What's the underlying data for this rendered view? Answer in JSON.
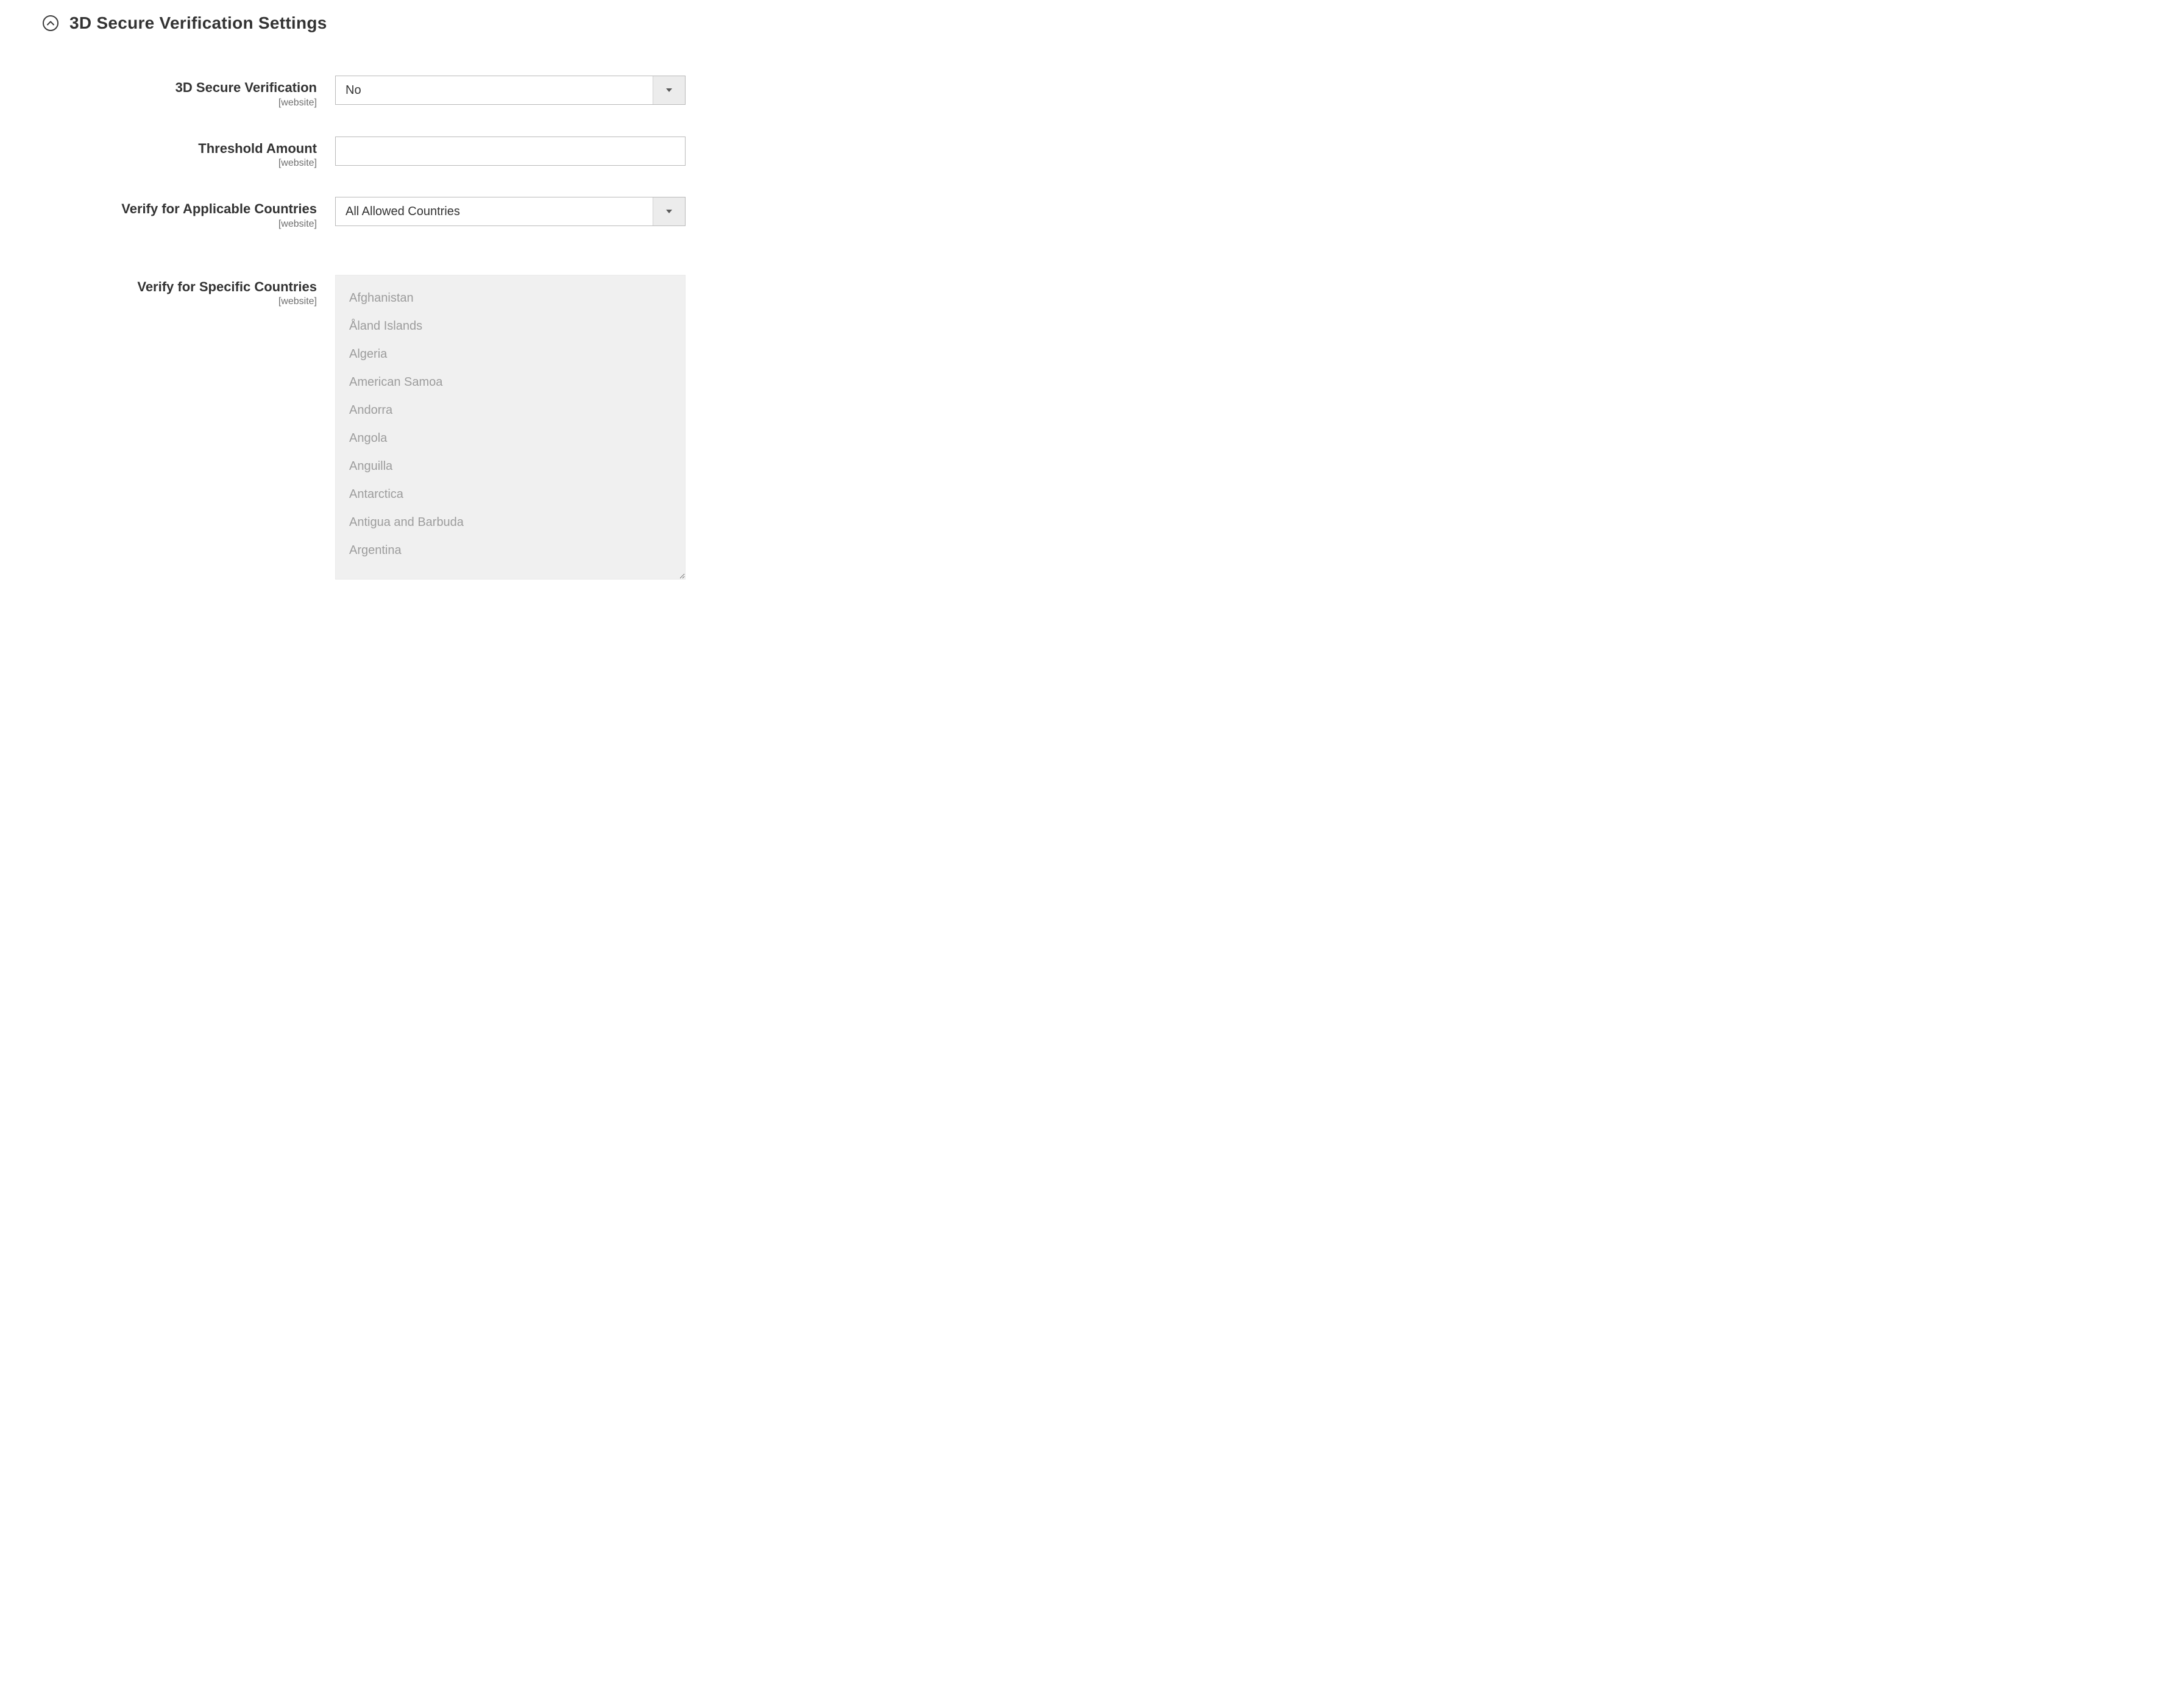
{
  "section": {
    "title": "3D Secure Verification Settings"
  },
  "fields": {
    "threeds": {
      "label": "3D Secure Verification",
      "scope": "[website]",
      "selected": "No"
    },
    "threshold": {
      "label": "Threshold Amount",
      "scope": "[website]",
      "value": ""
    },
    "applicableCountries": {
      "label": "Verify for Applicable Countries",
      "scope": "[website]",
      "selected": "All Allowed Countries"
    },
    "specificCountries": {
      "label": "Verify for Specific Countries",
      "scope": "[website]",
      "options": [
        "Afghanistan",
        "Åland Islands",
        "Algeria",
        "American Samoa",
        "Andorra",
        "Angola",
        "Anguilla",
        "Antarctica",
        "Antigua and Barbuda",
        "Argentina"
      ]
    }
  }
}
